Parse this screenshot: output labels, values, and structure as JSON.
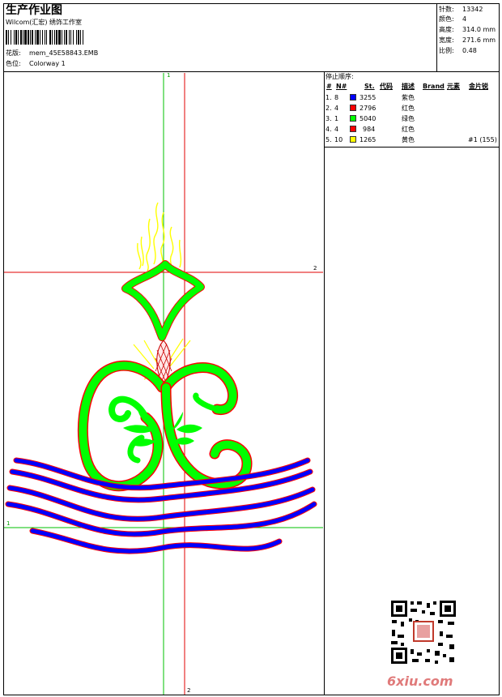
{
  "header": {
    "title": "生产作业图",
    "company": "Wilcom(汇宏) 绣饰工作室",
    "design_label": "花版:",
    "design_file": "mem_45E58843.EMB",
    "colorway_label": "色位:",
    "colorway_name": "Colorway 1"
  },
  "specs": [
    {
      "label": "针数:",
      "value": "13342"
    },
    {
      "label": "颜色:",
      "value": "4"
    },
    {
      "label": "高度:",
      "value": "314.0 mm"
    },
    {
      "label": "宽度:",
      "value": "271.6 mm"
    },
    {
      "label": "比例:",
      "value": "0.48"
    }
  ],
  "stop_sequence": {
    "title": "停止顺序:",
    "columns": [
      "#",
      "N#",
      "St.",
      "代码",
      "描述",
      "Brand",
      "元素",
      "金片锐"
    ],
    "rows": [
      {
        "num": "1.",
        "n": "8",
        "swatch": "#0000ff",
        "st": "3255",
        "desc": "紫色",
        "extra": ""
      },
      {
        "num": "2.",
        "n": "4",
        "swatch": "#ff0000",
        "st": "2796",
        "desc": "红色",
        "extra": ""
      },
      {
        "num": "3.",
        "n": "1",
        "swatch": "#00ff00",
        "st": "5040",
        "desc": "绿色",
        "extra": ""
      },
      {
        "num": "4.",
        "n": "4",
        "swatch": "#ff0000",
        "st": "984",
        "desc": "红色",
        "extra": ""
      },
      {
        "num": "5.",
        "n": "10",
        "swatch": "#ffff00",
        "st": "1265",
        "desc": "黄色",
        "extra": "#1 (155)"
      }
    ]
  },
  "guides": {
    "v1_label": "1",
    "v2_label": "2",
    "h1_label": "1",
    "h2_label": "2"
  },
  "watermark": {
    "site": "6xiu.com",
    "qr_icon": "qr-code-icon"
  },
  "colors": {
    "green": "#00ff00",
    "red": "#ff0000",
    "blue": "#0000ff",
    "yellow": "#ffff00",
    "guide_green": "#00c000",
    "guide_red": "#e00000"
  }
}
